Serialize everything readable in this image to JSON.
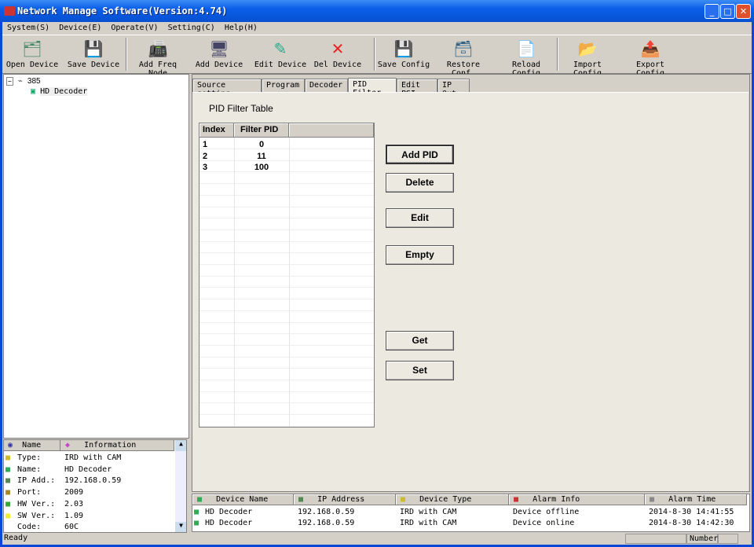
{
  "window": {
    "title": "Network Manage Software(Version:4.74)"
  },
  "menu": [
    "System(S)",
    "Device(E)",
    "Operate(V)",
    "Setting(C)",
    "Help(H)"
  ],
  "toolbar": [
    {
      "label": "Open Device",
      "icon": "open-device-icon",
      "glyph": "🗂"
    },
    {
      "label": "Save Device",
      "icon": "save-device-icon",
      "glyph": "💾"
    },
    {
      "label": "Add Freq Node",
      "icon": "add-freq-node-icon",
      "glyph": "📠"
    },
    {
      "label": "Add Device",
      "icon": "add-device-icon",
      "glyph": "🖥"
    },
    {
      "label": "Edit Device",
      "icon": "edit-device-icon",
      "glyph": "✎"
    },
    {
      "label": "Del Device",
      "icon": "del-device-icon",
      "glyph": "✕"
    },
    {
      "label": "Save Config",
      "icon": "save-config-icon",
      "glyph": "💾"
    },
    {
      "label": "Restore Conf.",
      "icon": "restore-config-icon",
      "glyph": "🗃"
    },
    {
      "label": "Reload Config",
      "icon": "reload-config-icon",
      "glyph": "📄"
    },
    {
      "label": "Import Config",
      "icon": "import-config-icon",
      "glyph": "📂"
    },
    {
      "label": "Export Config",
      "icon": "export-config-icon",
      "glyph": "📤"
    }
  ],
  "tree": {
    "root": "385",
    "child": "HD Decoder"
  },
  "info": {
    "headers": [
      "Name",
      "Information"
    ],
    "rows": [
      {
        "name": "Type:",
        "value": "IRD with CAM"
      },
      {
        "name": "Name:",
        "value": "HD Decoder"
      },
      {
        "name": "IP Add.:",
        "value": "192.168.0.59"
      },
      {
        "name": "Port:",
        "value": "2009"
      },
      {
        "name": "HW Ver.:",
        "value": "2.03"
      },
      {
        "name": "SW Ver.:",
        "value": "1.09"
      },
      {
        "name": "Code:",
        "value": "60C"
      }
    ]
  },
  "tabs": [
    "Source setting",
    "Program",
    "Decoder",
    "PID Filter",
    "Edit PSI",
    "IP Out"
  ],
  "active_tab": "PID Filter",
  "pid": {
    "title": "PID Filter Table",
    "headers": [
      "Index",
      "Filter PID"
    ],
    "rows": [
      [
        "1",
        "0"
      ],
      [
        "2",
        "11"
      ],
      [
        "3",
        "100"
      ]
    ]
  },
  "buttons": {
    "add": "Add PID",
    "delete": "Delete",
    "edit": "Edit",
    "empty": "Empty",
    "get": "Get",
    "set": "Set"
  },
  "alarm": {
    "headers": [
      "Device Name",
      "IP Address",
      "Device Type",
      "Alarm Info",
      "Alarm Time"
    ],
    "rows": [
      [
        "HD Decoder",
        "192.168.0.59",
        "IRD with CAM",
        "Device offline",
        "2014-8-30 14:41:55"
      ],
      [
        "HD Decoder",
        "192.168.0.59",
        "IRD with CAM",
        "Device online",
        "2014-8-30 14:42:30"
      ]
    ]
  },
  "status": {
    "text": "Ready",
    "number": "Number"
  }
}
